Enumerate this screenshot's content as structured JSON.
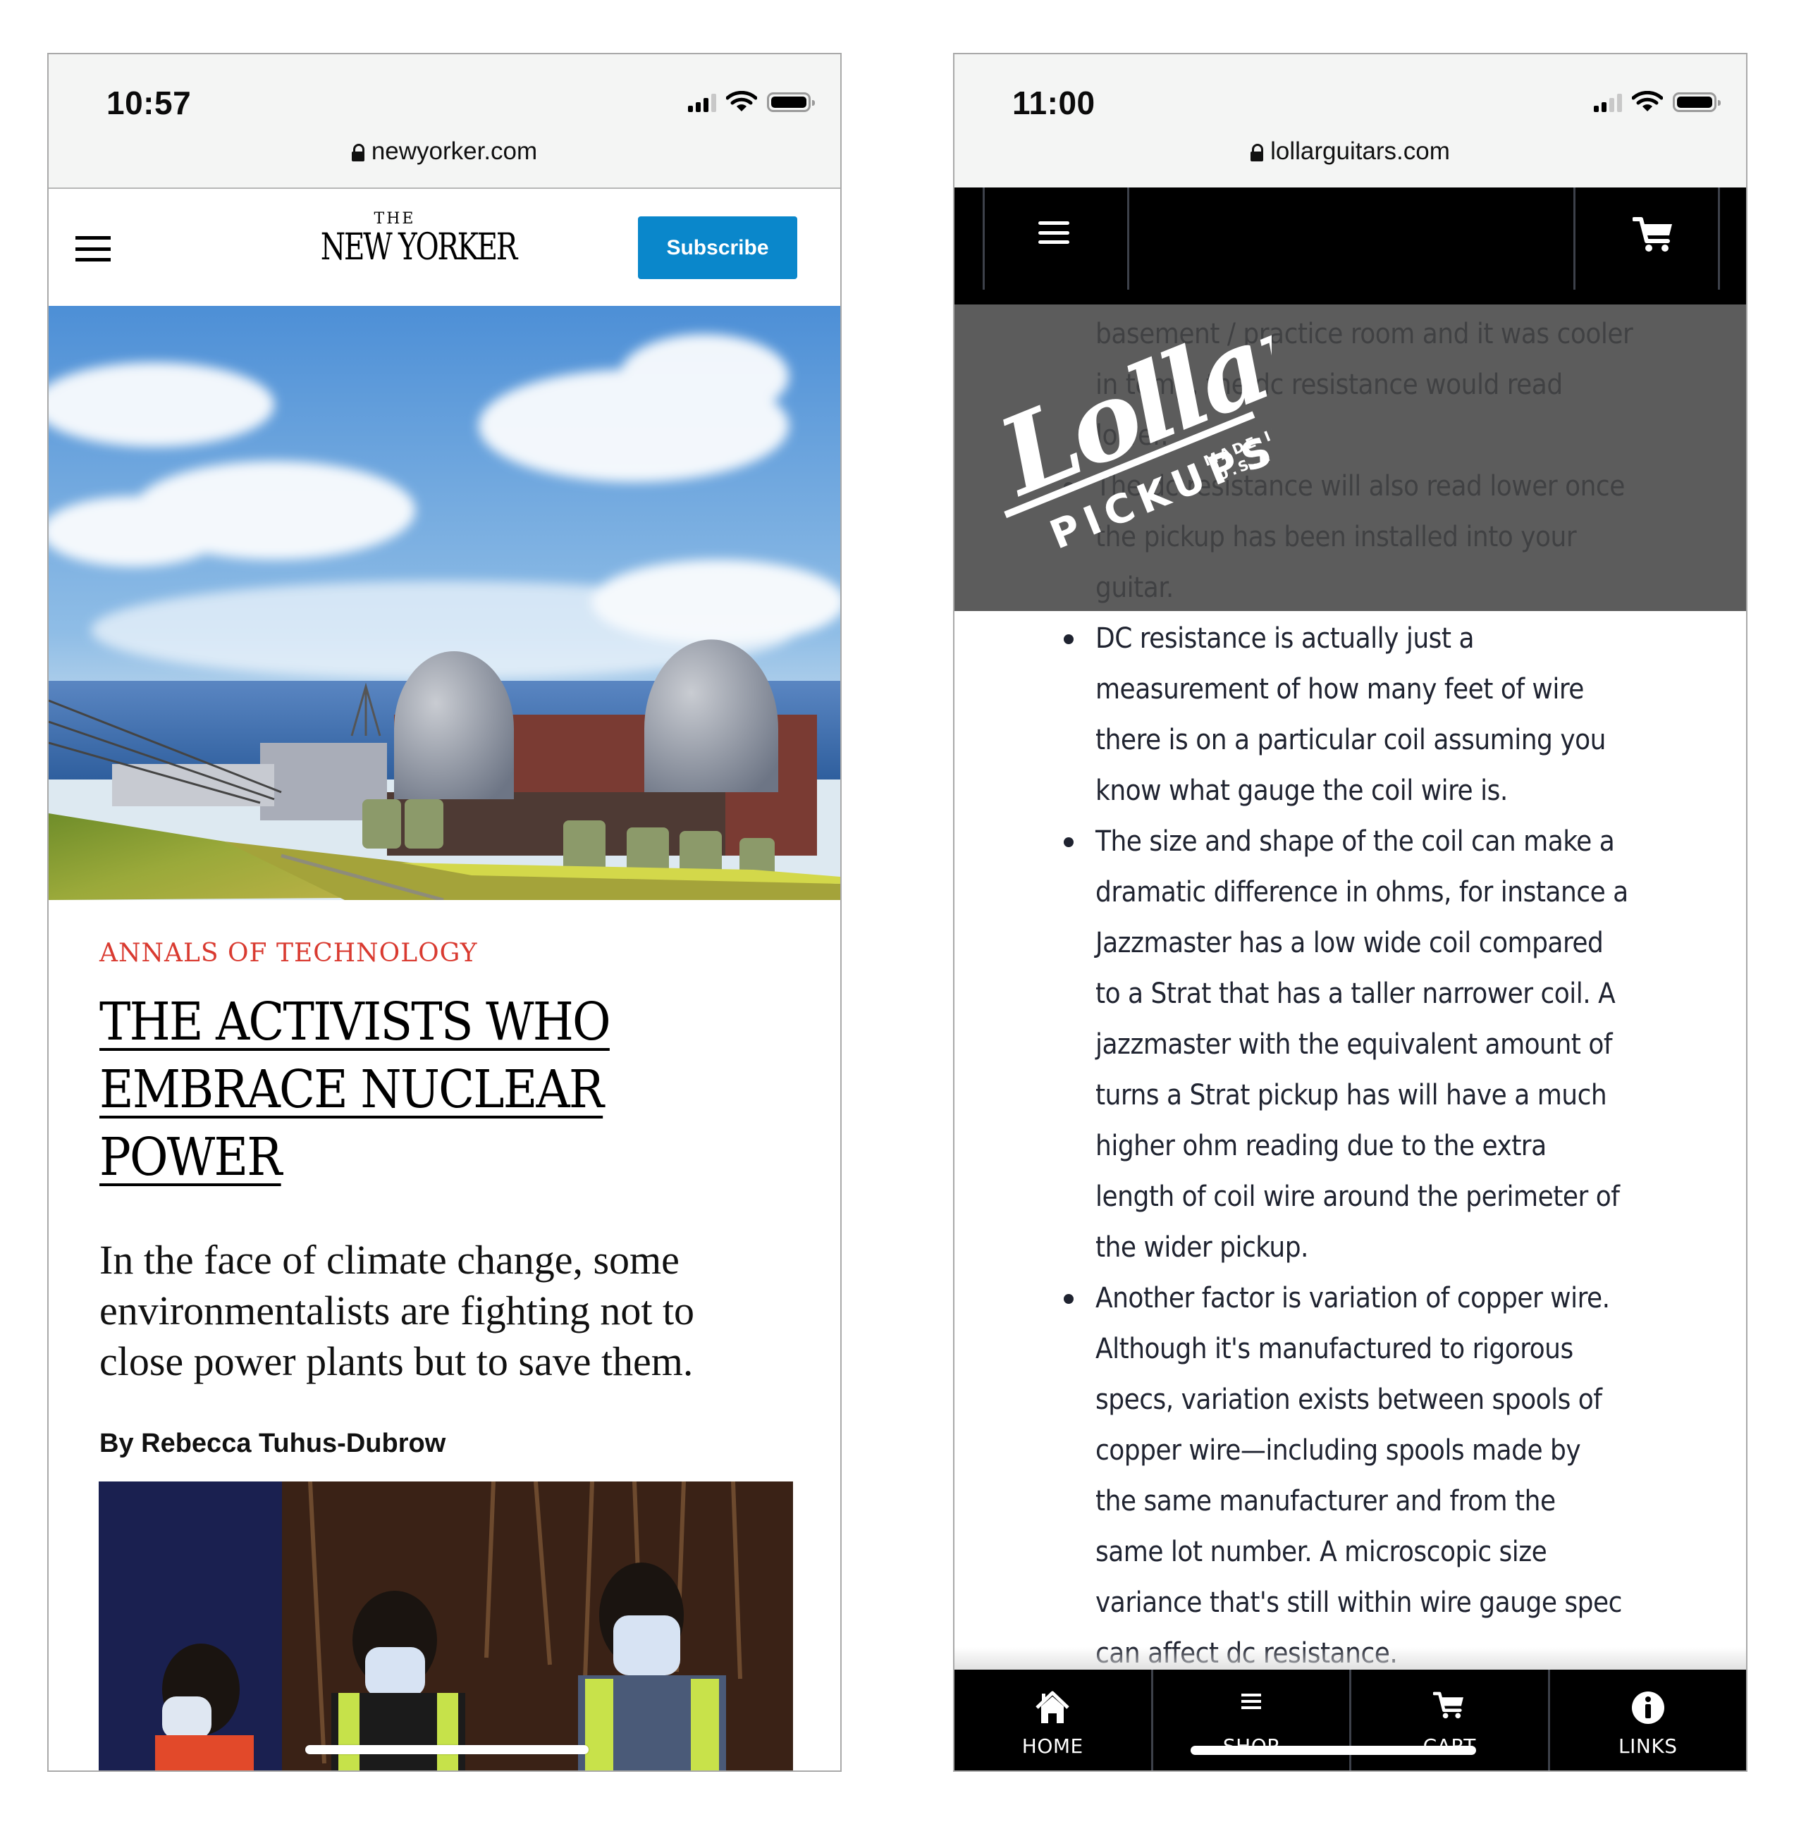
{
  "left_phone": {
    "status": {
      "time": "10:57",
      "signal_bars": 3,
      "signal_max": 4,
      "wifi": "wifi-icon",
      "battery": "battery-full-icon"
    },
    "browser": {
      "url": "newyorker.com",
      "secure": true
    },
    "header": {
      "menu_icon": "hamburger-menu-icon",
      "logo_the": "THE",
      "logo_name": "NEW YORKER",
      "subscribe_label": "Subscribe",
      "accent_color": "#0a87cb"
    },
    "article": {
      "hero_image": "painting of nuclear power plant with two containment domes by the ocean",
      "rubric": "ANNALS OF TECHNOLOGY",
      "rubric_color": "#d93a30",
      "headline_lines": [
        "THE ACTIVISTS WHO",
        "EMBRACE NUCLEAR",
        "POWER"
      ],
      "dek_lines": [
        "In the face of climate change, some",
        "environmentalists are fighting not to",
        "close power plants but to save them."
      ],
      "byline": "By Rebecca Tuhus-Dubrow",
      "photo": "three young people wearing face masks and safety vests at night"
    }
  },
  "right_phone": {
    "status": {
      "time": "11:00",
      "signal_bars": 2,
      "signal_max": 4,
      "wifi": "wifi-icon",
      "battery": "battery-full-icon"
    },
    "browser": {
      "url": "lollarguitars.com",
      "secure": true
    },
    "header": {
      "menu_icon": "hamburger-menu-icon",
      "cart_icon": "cart-icon"
    },
    "logo": {
      "brand": "Lollar",
      "sub": "PICKUPS",
      "made_in": "MADE IN",
      "country": "U.S.A."
    },
    "content_lines": [
      {
        "text": "basement / practice room and it was cooler",
        "bullet": false
      },
      {
        "text": "in temp, the dc resistance would read",
        "bullet": false
      },
      {
        "text": "lower.",
        "bullet": false
      },
      {
        "text": "The dc resistance will also read lower once",
        "bullet": true
      },
      {
        "text": "the pickup has been installed into your",
        "bullet": false
      },
      {
        "text": "guitar.",
        "bullet": false
      },
      {
        "text": "DC resistance is actually just a",
        "bullet": true
      },
      {
        "text": "measurement of how many feet of wire",
        "bullet": false
      },
      {
        "text": "there is on a particular coil assuming you",
        "bullet": false
      },
      {
        "text": "know what gauge the coil wire is.",
        "bullet": false
      },
      {
        "text": "The size and shape of the coil can make a",
        "bullet": true
      },
      {
        "text": "dramatic difference in ohms, for instance a",
        "bullet": false
      },
      {
        "text": "Jazzmaster has a low wide coil compared",
        "bullet": false
      },
      {
        "text": "to a Strat that has a taller narrower coil. A",
        "bullet": false
      },
      {
        "text": "jazzmaster with the equivalent amount of",
        "bullet": false
      },
      {
        "text": "turns a Strat pickup has will have a much",
        "bullet": false
      },
      {
        "text": "higher ohm reading due to the extra",
        "bullet": false
      },
      {
        "text": "length of coil wire around the perimeter of",
        "bullet": false
      },
      {
        "text": "the wider pickup.",
        "bullet": false
      },
      {
        "text": "Another factor is variation of copper wire.",
        "bullet": true
      },
      {
        "text": "Although it's manufactured to rigorous",
        "bullet": false
      },
      {
        "text": "specs, variation exists between spools of",
        "bullet": false
      },
      {
        "text": "copper wire—including spools made by",
        "bullet": false
      },
      {
        "text": "the same manufacturer and from the",
        "bullet": false
      },
      {
        "text": "same lot number. A microscopic size",
        "bullet": false
      },
      {
        "text": "variance that's still within wire gauge spec",
        "bullet": false
      },
      {
        "text": "can affect dc resistance.",
        "bullet": false
      }
    ],
    "bottom_nav": [
      {
        "label": "HOME",
        "icon": "home-icon"
      },
      {
        "label": "SHOP",
        "icon": "menu-icon"
      },
      {
        "label": "CART",
        "icon": "cart-icon"
      },
      {
        "label": "LINKS",
        "icon": "info-icon"
      }
    ]
  }
}
